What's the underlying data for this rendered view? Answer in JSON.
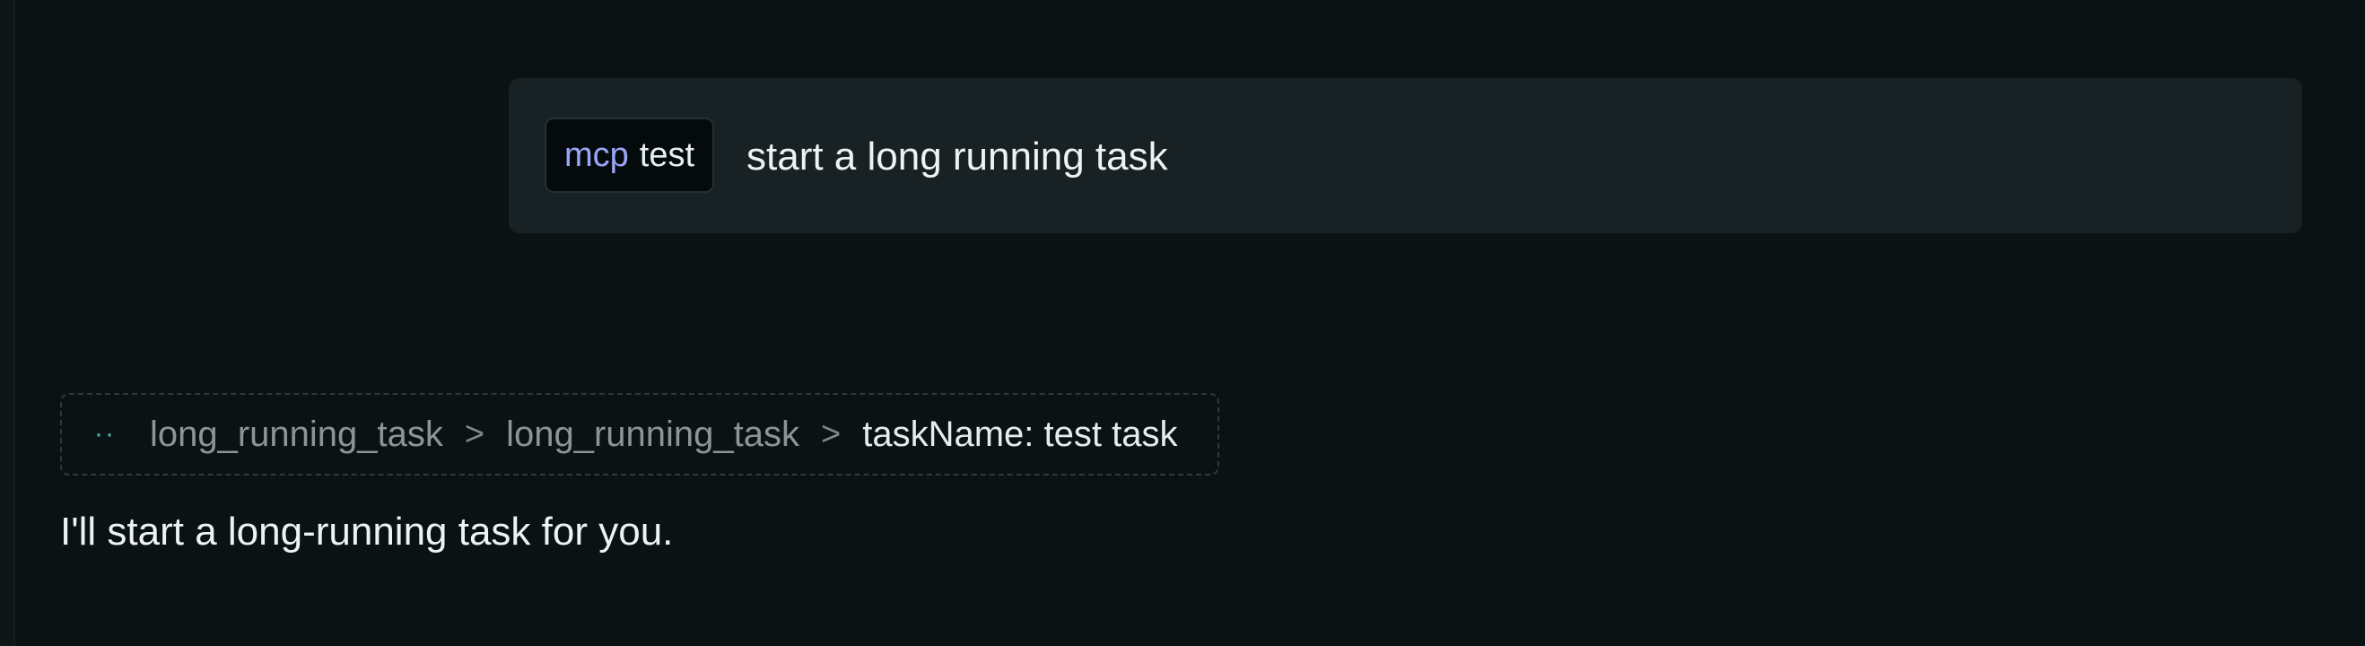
{
  "user_message": {
    "chip": {
      "kind": "mcp",
      "name": "test"
    },
    "text": "start a long running task"
  },
  "tool_call": {
    "status_icon": "loading-dots-icon",
    "status_glyph": "··",
    "crumbs": [
      "long_running_task",
      "long_running_task"
    ],
    "separator": ">",
    "argument": "taskName: test task"
  },
  "assistant_message": {
    "text": "I'll start a long-running task for you."
  },
  "colors": {
    "background": "#0b1214",
    "bubble": "#182123",
    "chip_kind": "#9aa6f6",
    "status_accent": "#4bb8b2"
  }
}
